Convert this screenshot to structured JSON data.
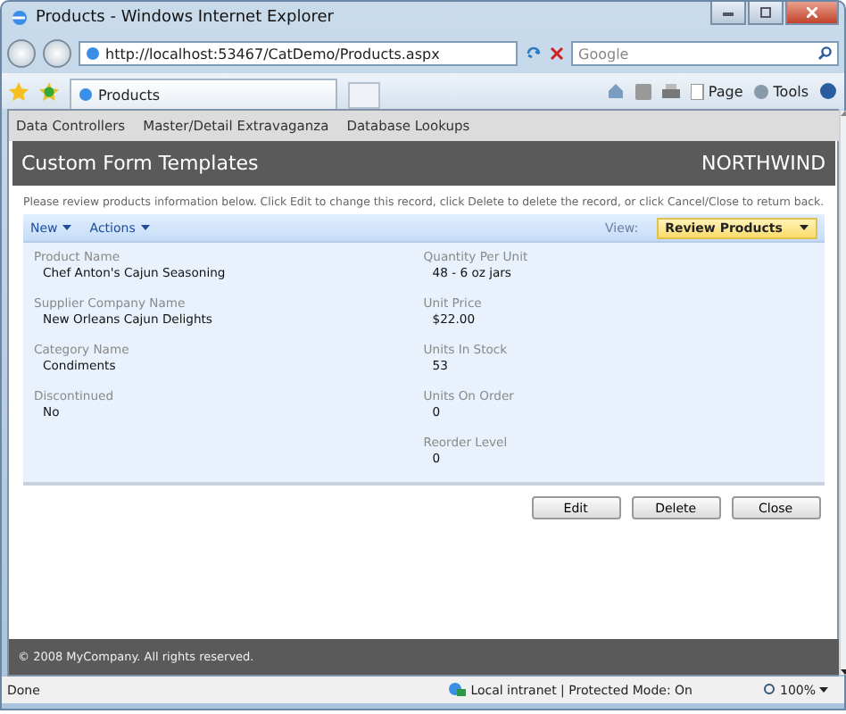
{
  "window": {
    "title": "Products - Windows Internet Explorer"
  },
  "address_bar": {
    "value": "http://localhost:53467/CatDemo/Products.aspx"
  },
  "search": {
    "placeholder": "Google"
  },
  "tab": {
    "label": "Products"
  },
  "command_bar": {
    "page": "Page",
    "tools": "Tools"
  },
  "menu": [
    "Data Controllers",
    "Master/Detail Extravaganza",
    "Database Lookups"
  ],
  "header": {
    "title": "Custom Form Templates",
    "brand": "NORTHWIND"
  },
  "instructions": "Please review products information below. Click Edit to change this record, click Delete to delete the record, or click Cancel/Close to return back.",
  "toolbar": {
    "actions": [
      "New",
      "Actions"
    ],
    "view_label": "View:",
    "view": "Review Products"
  },
  "fields": {
    "left": [
      {
        "label": "Product Name",
        "value": "Chef Anton's Cajun Seasoning"
      },
      {
        "label": "Supplier Company Name",
        "value": "New Orleans Cajun Delights"
      },
      {
        "label": "Category Name",
        "value": "Condiments"
      },
      {
        "label": "Discontinued",
        "value": "No"
      }
    ],
    "right": [
      {
        "label": "Quantity Per Unit",
        "value": "48 - 6 oz jars"
      },
      {
        "label": "Unit Price",
        "value": "$22.00"
      },
      {
        "label": "Units In Stock",
        "value": "53"
      },
      {
        "label": "Units On Order",
        "value": "0"
      },
      {
        "label": "Reorder Level",
        "value": "0"
      }
    ]
  },
  "buttons": [
    "Edit",
    "Delete",
    "Close"
  ],
  "footer": "© 2008 MyCompany. All rights reserved.",
  "status_bar": {
    "text": "Done",
    "zone": "Local intranet | Protected Mode: On",
    "zoom": "100%"
  }
}
